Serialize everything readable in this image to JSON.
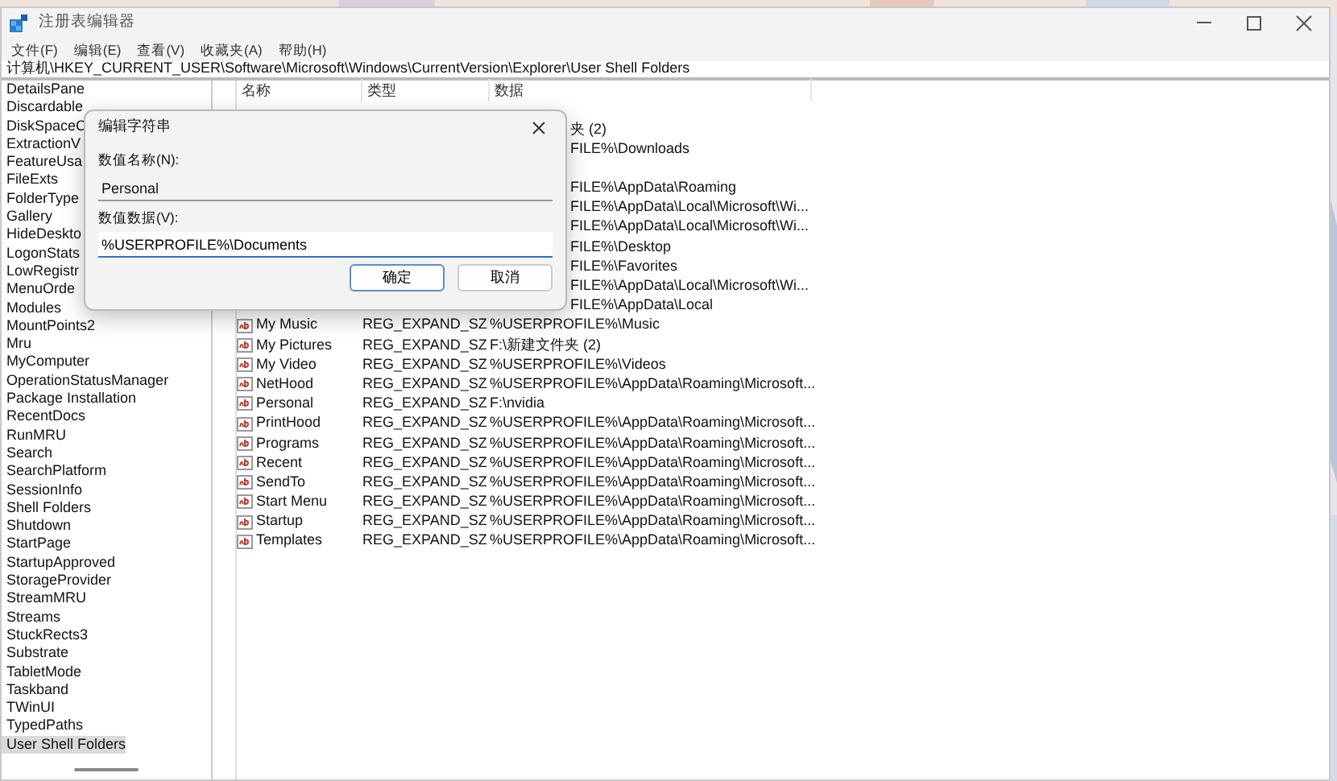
{
  "window": {
    "title": "注册表编辑器",
    "menu": [
      "文件(F)",
      "编辑(E)",
      "查看(V)",
      "收藏夹(A)",
      "帮助(H)"
    ],
    "address": "计算机\\HKEY_CURRENT_USER\\Software\\Microsoft\\Windows\\CurrentVersion\\Explorer\\User Shell Folders"
  },
  "tree": {
    "items": [
      {
        "label": "DetailsPane",
        "selected": false
      },
      {
        "label": "Discardable",
        "selected": false
      },
      {
        "label": "DiskSpaceC",
        "selected": false
      },
      {
        "label": "ExtractionV",
        "selected": false
      },
      {
        "label": "FeatureUsa",
        "selected": false
      },
      {
        "label": "FileExts",
        "selected": false
      },
      {
        "label": "FolderType",
        "selected": false
      },
      {
        "label": "Gallery",
        "selected": false
      },
      {
        "label": "HideDeskto",
        "selected": false
      },
      {
        "label": "LogonStats",
        "selected": false
      },
      {
        "label": "LowRegistr",
        "selected": false
      },
      {
        "label": "MenuOrde",
        "selected": false
      },
      {
        "label": "Modules",
        "selected": false
      },
      {
        "label": "MountPoints2",
        "selected": false
      },
      {
        "label": "Mru",
        "selected": false
      },
      {
        "label": "MyComputer",
        "selected": false
      },
      {
        "label": "OperationStatusManager",
        "selected": false
      },
      {
        "label": "Package Installation",
        "selected": false
      },
      {
        "label": "RecentDocs",
        "selected": false
      },
      {
        "label": "RunMRU",
        "selected": false
      },
      {
        "label": "Search",
        "selected": false
      },
      {
        "label": "SearchPlatform",
        "selected": false
      },
      {
        "label": "SessionInfo",
        "selected": false
      },
      {
        "label": "Shell Folders",
        "selected": false
      },
      {
        "label": "Shutdown",
        "selected": false
      },
      {
        "label": "StartPage",
        "selected": false
      },
      {
        "label": "StartupApproved",
        "selected": false
      },
      {
        "label": "StorageProvider",
        "selected": false
      },
      {
        "label": "StreamMRU",
        "selected": false
      },
      {
        "label": "Streams",
        "selected": false
      },
      {
        "label": "StuckRects3",
        "selected": false
      },
      {
        "label": "Substrate",
        "selected": false
      },
      {
        "label": "TabletMode",
        "selected": false
      },
      {
        "label": "Taskband",
        "selected": false
      },
      {
        "label": "TWinUI",
        "selected": false
      },
      {
        "label": "TypedPaths",
        "selected": false
      },
      {
        "label": "User Shell Folders",
        "selected": true
      }
    ]
  },
  "table": {
    "columns": [
      "名称",
      "类型",
      "数据"
    ],
    "rows": [
      {},
      {
        "data": "夹 (2)"
      },
      {
        "data": "FILE%\\Downloads"
      },
      {},
      {
        "data": "FILE%\\AppData\\Roaming"
      },
      {
        "data": "FILE%\\AppData\\Local\\Microsoft\\Wi..."
      },
      {
        "data": "FILE%\\AppData\\Local\\Microsoft\\Wi..."
      },
      {
        "data": "FILE%\\Desktop"
      },
      {
        "data": "FILE%\\Favorites"
      },
      {
        "data": "FILE%\\AppData\\Local\\Microsoft\\Wi..."
      },
      {
        "data": "FILE%\\AppData\\Local"
      },
      {
        "name": "My Music",
        "type": "REG_EXPAND_SZ",
        "data": "%USERPROFILE%\\Music"
      },
      {
        "name": "My Pictures",
        "type": "REG_EXPAND_SZ",
        "data": "F:\\新建文件夹 (2)"
      },
      {
        "name": "My Video",
        "type": "REG_EXPAND_SZ",
        "data": "%USERPROFILE%\\Videos"
      },
      {
        "name": "NetHood",
        "type": "REG_EXPAND_SZ",
        "data": "%USERPROFILE%\\AppData\\Roaming\\Microsoft..."
      },
      {
        "name": "Personal",
        "type": "REG_EXPAND_SZ",
        "data": "F:\\nvidia"
      },
      {
        "name": "PrintHood",
        "type": "REG_EXPAND_SZ",
        "data": "%USERPROFILE%\\AppData\\Roaming\\Microsoft..."
      },
      {
        "name": "Programs",
        "type": "REG_EXPAND_SZ",
        "data": "%USERPROFILE%\\AppData\\Roaming\\Microsoft..."
      },
      {
        "name": "Recent",
        "type": "REG_EXPAND_SZ",
        "data": "%USERPROFILE%\\AppData\\Roaming\\Microsoft..."
      },
      {
        "name": "SendTo",
        "type": "REG_EXPAND_SZ",
        "data": "%USERPROFILE%\\AppData\\Roaming\\Microsoft..."
      },
      {
        "name": "Start Menu",
        "type": "REG_EXPAND_SZ",
        "data": "%USERPROFILE%\\AppData\\Roaming\\Microsoft..."
      },
      {
        "name": "Startup",
        "type": "REG_EXPAND_SZ",
        "data": "%USERPROFILE%\\AppData\\Roaming\\Microsoft..."
      },
      {
        "name": "Templates",
        "type": "REG_EXPAND_SZ",
        "data": "%USERPROFILE%\\AppData\\Roaming\\Microsoft..."
      }
    ]
  },
  "dialog": {
    "title": "编辑字符串",
    "name_label": "数值名称(N):",
    "name_value": "Personal",
    "data_label": "数值数据(V):",
    "data_value": "%USERPROFILE%\\Documents",
    "buttons": [
      {
        "label": "确定",
        "default": true
      },
      {
        "label": "取消",
        "default": false
      }
    ]
  }
}
